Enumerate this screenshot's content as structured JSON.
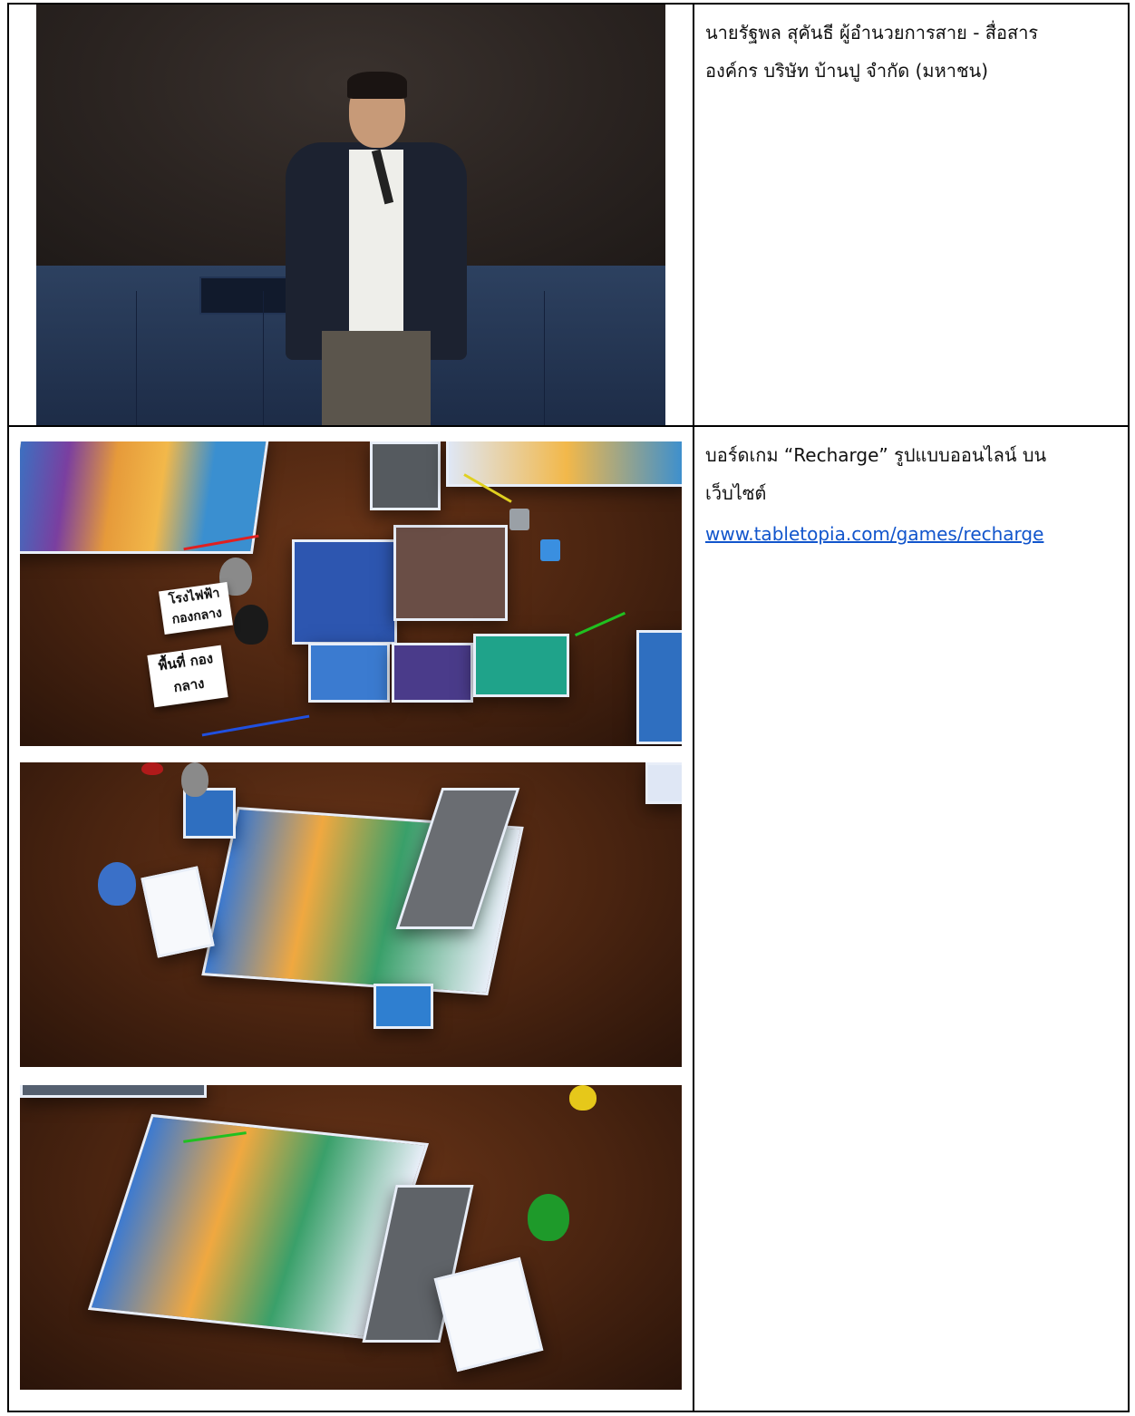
{
  "rows": [
    {
      "caption_line1": "นายรัฐพล สุคันธี ผู้อำนวยการสาย - สื่อสาร",
      "caption_line2": "องค์กร บริษัท บ้านปู จำกัด (มหาชน)"
    },
    {
      "caption_line1": "บอร์ดเกม “Recharge” รูปแบบออนไลน์ บน",
      "caption_line2": "เว็บไซต์",
      "link_text": "www.tabletopia.com/games/recharge"
    }
  ],
  "screens": {
    "shot1_card_power": "โรงไฟฟ้า กองกลาง",
    "shot1_card_area": "พื้นที่ กองกลาง"
  },
  "colors": {
    "table_wood": "#4a2410",
    "board_blue": "#2f5fb0",
    "link": "#1155cc"
  }
}
